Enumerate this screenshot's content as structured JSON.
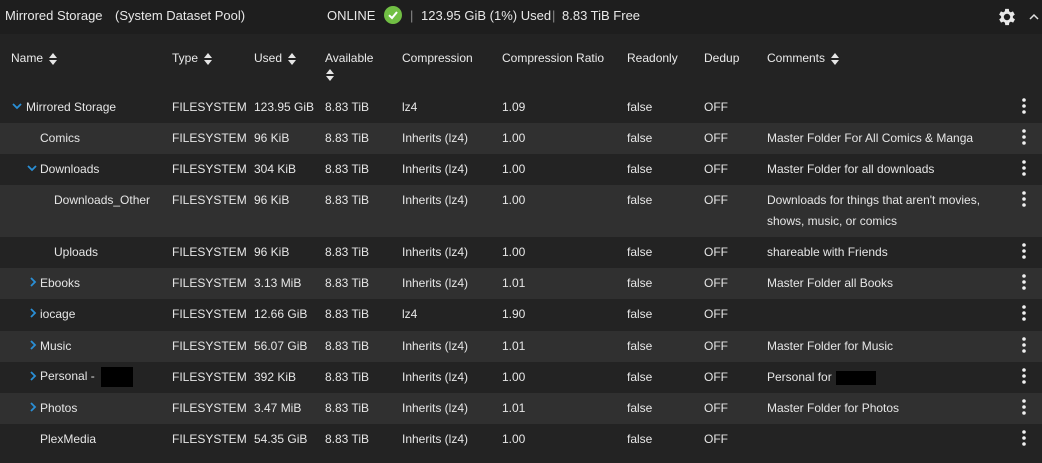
{
  "pool": {
    "name": "Mirrored Storage",
    "subtitle": "(System Dataset Pool)",
    "status": "ONLINE",
    "separator": "|",
    "used": "123.95 GiB (1%) Used",
    "free": "8.83 TiB Free"
  },
  "columns": [
    "Name",
    "Type",
    "Used",
    "Available",
    "Compression",
    "Compression Ratio",
    "Readonly",
    "Dedup",
    "Comments"
  ],
  "rows": [
    {
      "name": "Mirrored Storage",
      "type": "FILESYSTEM",
      "used": "123.95 GiB",
      "available": "8.83 TiB",
      "compression": "lz4",
      "ratio": "1.09",
      "readonly": "false",
      "dedup": "OFF",
      "comments": ""
    },
    {
      "name": "Comics",
      "type": "FILESYSTEM",
      "used": "96 KiB",
      "available": "8.83 TiB",
      "compression": "Inherits (lz4)",
      "ratio": "1.00",
      "readonly": "false",
      "dedup": "OFF",
      "comments": "Master Folder For All Comics & Manga"
    },
    {
      "name": "Downloads",
      "type": "FILESYSTEM",
      "used": "304 KiB",
      "available": "8.83 TiB",
      "compression": "Inherits (lz4)",
      "ratio": "1.00",
      "readonly": "false",
      "dedup": "OFF",
      "comments": "Master Folder for all downloads"
    },
    {
      "name": "Downloads_Other",
      "type": "FILESYSTEM",
      "used": "96 KiB",
      "available": "8.83 TiB",
      "compression": "Inherits (lz4)",
      "ratio": "1.00",
      "readonly": "false",
      "dedup": "OFF",
      "comments": "Downloads for things that aren't movies, shows, music, or comics"
    },
    {
      "name": "Uploads",
      "type": "FILESYSTEM",
      "used": "96 KiB",
      "available": "8.83 TiB",
      "compression": "Inherits (lz4)",
      "ratio": "1.00",
      "readonly": "false",
      "dedup": "OFF",
      "comments": "shareable with Friends"
    },
    {
      "name": "Ebooks",
      "type": "FILESYSTEM",
      "used": "3.13 MiB",
      "available": "8.83 TiB",
      "compression": "Inherits (lz4)",
      "ratio": "1.01",
      "readonly": "false",
      "dedup": "OFF",
      "comments": "Master Folder all Books"
    },
    {
      "name": "iocage",
      "type": "FILESYSTEM",
      "used": "12.66 GiB",
      "available": "8.83 TiB",
      "compression": "lz4",
      "ratio": "1.90",
      "readonly": "false",
      "dedup": "OFF",
      "comments": ""
    },
    {
      "name": "Music",
      "type": "FILESYSTEM",
      "used": "56.07 GiB",
      "available": "8.83 TiB",
      "compression": "Inherits (lz4)",
      "ratio": "1.01",
      "readonly": "false",
      "dedup": "OFF",
      "comments": "Master Folder for Music"
    },
    {
      "name": "Personal -",
      "type": "FILESYSTEM",
      "used": "392 KiB",
      "available": "8.83 TiB",
      "compression": "Inherits (lz4)",
      "ratio": "1.00",
      "readonly": "false",
      "dedup": "OFF",
      "comments": "Personal for"
    },
    {
      "name": "Photos",
      "type": "FILESYSTEM",
      "used": "3.47 MiB",
      "available": "8.83 TiB",
      "compression": "Inherits (lz4)",
      "ratio": "1.01",
      "readonly": "false",
      "dedup": "OFF",
      "comments": "Master Folder for Photos"
    },
    {
      "name": "PlexMedia",
      "type": "FILESYSTEM",
      "used": "54.35 GiB",
      "available": "8.83 TiB",
      "compression": "Inherits (lz4)",
      "ratio": "1.00",
      "readonly": "false",
      "dedup": "OFF",
      "comments": ""
    }
  ],
  "icons": {
    "status": "check-circle-icon",
    "settings": "gear-icon",
    "collapse": "chevron-up-icon",
    "expand": "chevron-right-icon",
    "expanded": "chevron-down-icon",
    "actions": "more-vert-icon"
  },
  "colors": {
    "accent": "#2a8fd6",
    "online": "#71bf44",
    "background": "#232323",
    "row_alt": "#303030"
  }
}
